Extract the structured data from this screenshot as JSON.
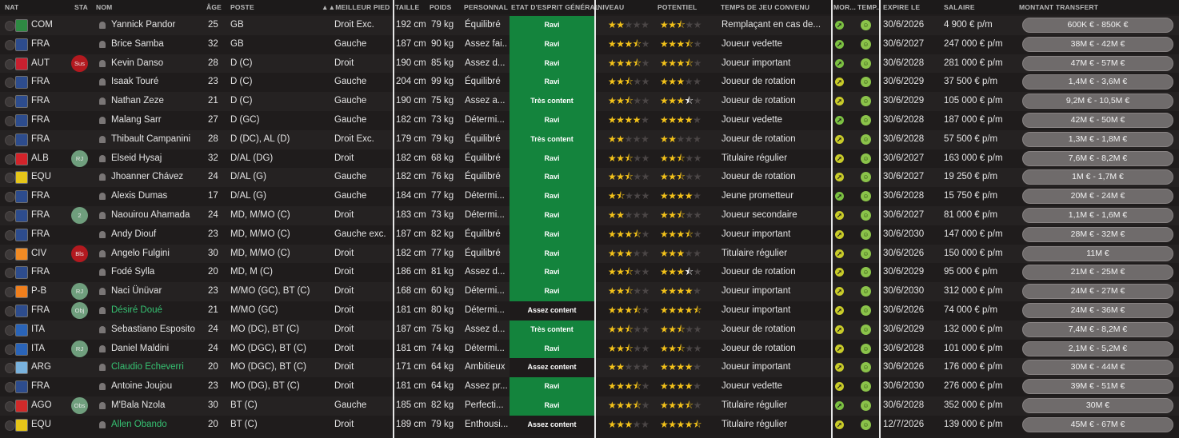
{
  "header": {
    "nat": "NAT",
    "sta": "STA",
    "nom": "NOM",
    "age": "ÂGE",
    "poste": "POSTE",
    "pied": "MEILLEUR PIED",
    "taille": "TAILLE",
    "poids": "POIDS",
    "perso": "PERSONNAL...",
    "etat": "ETAT D'ESPRIT GÉNÉRAL",
    "niveau": "NIVEAU",
    "potentiel": "POTENTIEL",
    "temps": "TEMPS DE JEU CONVENU",
    "mor": "MOR...",
    "temp": "TEMP...",
    "expire": "EXPIRE LE",
    "salaire": "SALAIRE",
    "transfert": "MONTANT TRANSFERT"
  },
  "colors": {
    "mood_green": "#14843d",
    "name_green": "#36c172",
    "star": "#f3c21a"
  },
  "players": [
    {
      "nat": "COM",
      "flag": "#2e8a43",
      "status": "",
      "status_color": "",
      "name": "Yannick Pandor",
      "green": false,
      "age": "25",
      "poste": "GB",
      "pied": "Droit Exc.",
      "taille": "192 cm",
      "poids": "79 kg",
      "perso": "Équilibré",
      "etat": "Ravi",
      "mood_green": true,
      "niveau": 2,
      "potentiel": 2.5,
      "pot_white": false,
      "temps": "Remplaçant en cas de...",
      "mor": "up",
      "mor_color": "#7cc142",
      "expire": "30/6/2026",
      "salaire": "4 900 € p/m",
      "transfert": "600K € - 850K €"
    },
    {
      "nat": "FRA",
      "flag": "#2d4c8d",
      "status": "",
      "status_color": "",
      "name": "Brice Samba",
      "green": false,
      "age": "32",
      "poste": "GB",
      "pied": "Gauche",
      "taille": "187 cm",
      "poids": "90 kg",
      "perso": "Assez fai...",
      "etat": "Ravi",
      "mood_green": true,
      "niveau": 3.5,
      "potentiel": 3.5,
      "pot_white": false,
      "temps": "Joueur vedette",
      "mor": "up",
      "mor_color": "#7cc142",
      "expire": "30/6/2027",
      "salaire": "247 000 € p/m",
      "transfert": "38M € - 42M €"
    },
    {
      "nat": "AUT",
      "flag": "#c8202f",
      "status": "Sus",
      "status_color": "#b3191f",
      "name": "Kevin Danso",
      "green": false,
      "age": "28",
      "poste": "D (C)",
      "pied": "Droit",
      "taille": "190 cm",
      "poids": "85 kg",
      "perso": "Assez d...",
      "etat": "Ravi",
      "mood_green": true,
      "niveau": 3.5,
      "potentiel": 3.5,
      "pot_white": false,
      "temps": "Joueur important",
      "mor": "up",
      "mor_color": "#7cc142",
      "expire": "30/6/2028",
      "salaire": "281 000 € p/m",
      "transfert": "47M € - 57M €"
    },
    {
      "nat": "FRA",
      "flag": "#2d4c8d",
      "status": "",
      "status_color": "",
      "name": "Isaak Touré",
      "green": false,
      "age": "23",
      "poste": "D (C)",
      "pied": "Gauche",
      "taille": "204 cm",
      "poids": "99 kg",
      "perso": "Équilibré",
      "etat": "Ravi",
      "mood_green": true,
      "niveau": 2.5,
      "potentiel": 3,
      "pot_white": false,
      "temps": "Joueur de rotation",
      "mor": "up",
      "mor_color": "#c9cc29",
      "expire": "30/6/2029",
      "salaire": "37 500 € p/m",
      "transfert": "1,4M € - 3,6M €"
    },
    {
      "nat": "FRA",
      "flag": "#2d4c8d",
      "status": "",
      "status_color": "",
      "name": "Nathan Zeze",
      "green": false,
      "age": "21",
      "poste": "D (C)",
      "pied": "Gauche",
      "taille": "190 cm",
      "poids": "75 kg",
      "perso": "Assez a...",
      "etat": "Très content",
      "mood_green": true,
      "niveau": 2.5,
      "potentiel": 3.5,
      "pot_white": true,
      "temps": "Joueur de rotation",
      "mor": "up",
      "mor_color": "#c9cc29",
      "expire": "30/6/2029",
      "salaire": "105 000 € p/m",
      "transfert": "9,2M € - 10,5M €"
    },
    {
      "nat": "FRA",
      "flag": "#2d4c8d",
      "status": "",
      "status_color": "",
      "name": "Malang Sarr",
      "green": false,
      "age": "27",
      "poste": "D (GC)",
      "pied": "Gauche",
      "taille": "182 cm",
      "poids": "73 kg",
      "perso": "Détermi...",
      "etat": "Ravi",
      "mood_green": true,
      "niveau": 4,
      "potentiel": 4,
      "pot_white": false,
      "temps": "Joueur vedette",
      "mor": "up",
      "mor_color": "#7cc142",
      "expire": "30/6/2028",
      "salaire": "187 000 € p/m",
      "transfert": "42M € - 50M €"
    },
    {
      "nat": "FRA",
      "flag": "#2d4c8d",
      "status": "",
      "status_color": "",
      "name": "Thibault Campanini",
      "green": false,
      "age": "28",
      "poste": "D (DC), AL (D)",
      "pied": "Droit Exc.",
      "taille": "179 cm",
      "poids": "79 kg",
      "perso": "Équilibré",
      "etat": "Très content",
      "mood_green": true,
      "niveau": 2,
      "potentiel": 2,
      "pot_white": false,
      "temps": "Joueur de rotation",
      "mor": "up",
      "mor_color": "#c9cc29",
      "expire": "30/6/2028",
      "salaire": "57 500 € p/m",
      "transfert": "1,3M € - 1,8M €"
    },
    {
      "nat": "ALB",
      "flag": "#d2232a",
      "status": "RJ",
      "status_color": "#6f9e7d",
      "name": "Elseid Hysaj",
      "green": false,
      "age": "32",
      "poste": "D/AL (DG)",
      "pied": "Droit",
      "taille": "182 cm",
      "poids": "68 kg",
      "perso": "Équilibré",
      "etat": "Ravi",
      "mood_green": true,
      "niveau": 2.5,
      "potentiel": 2.5,
      "pot_white": false,
      "temps": "Titulaire régulier",
      "mor": "up",
      "mor_color": "#c9cc29",
      "expire": "30/6/2027",
      "salaire": "163 000 € p/m",
      "transfert": "7,6M € - 8,2M €"
    },
    {
      "nat": "EQU",
      "flag": "#e6c619",
      "status": "",
      "status_color": "",
      "name": "Jhoanner Chávez",
      "green": false,
      "age": "24",
      "poste": "D/AL (G)",
      "pied": "Gauche",
      "taille": "182 cm",
      "poids": "76 kg",
      "perso": "Équilibré",
      "etat": "Ravi",
      "mood_green": true,
      "niveau": 2.5,
      "potentiel": 2.5,
      "pot_white": false,
      "temps": "Joueur de rotation",
      "mor": "up",
      "mor_color": "#c9cc29",
      "expire": "30/6/2027",
      "salaire": "19 250 € p/m",
      "transfert": "1M € - 1,7M €"
    },
    {
      "nat": "FRA",
      "flag": "#2d4c8d",
      "status": "",
      "status_color": "",
      "name": "Alexis Dumas",
      "green": false,
      "age": "17",
      "poste": "D/AL (G)",
      "pied": "Gauche",
      "taille": "184 cm",
      "poids": "77 kg",
      "perso": "Détermi...",
      "etat": "Ravi",
      "mood_green": true,
      "niveau": 1.5,
      "potentiel": 4,
      "pot_white": true,
      "temps": "Jeune prometteur",
      "mor": "up",
      "mor_color": "#7cc142",
      "expire": "30/6/2028",
      "salaire": "15 750 € p/m",
      "transfert": "20M € - 24M €"
    },
    {
      "nat": "FRA",
      "flag": "#2d4c8d",
      "status": "2",
      "status_color": "#6f9e7d",
      "name": "Naouirou Ahamada",
      "green": false,
      "age": "24",
      "poste": "MD, M/MO (C)",
      "pied": "Droit",
      "taille": "183 cm",
      "poids": "73 kg",
      "perso": "Détermi...",
      "etat": "Ravi",
      "mood_green": true,
      "niveau": 2,
      "potentiel": 2.5,
      "pot_white": false,
      "temps": "Joueur secondaire",
      "mor": "up",
      "mor_color": "#c9cc29",
      "expire": "30/6/2027",
      "salaire": "81 000 € p/m",
      "transfert": "1,1M € - 1,6M €"
    },
    {
      "nat": "FRA",
      "flag": "#2d4c8d",
      "status": "",
      "status_color": "",
      "name": "Andy Diouf",
      "green": false,
      "age": "23",
      "poste": "MD, M/MO (C)",
      "pied": "Gauche exc.",
      "taille": "187 cm",
      "poids": "82 kg",
      "perso": "Équilibré",
      "etat": "Ravi",
      "mood_green": true,
      "niveau": 3.5,
      "potentiel": 3.5,
      "pot_white": false,
      "temps": "Joueur important",
      "mor": "up",
      "mor_color": "#c9cc29",
      "expire": "30/6/2030",
      "salaire": "147 000 € p/m",
      "transfert": "28M € - 32M €"
    },
    {
      "nat": "CIV",
      "flag": "#f08a24",
      "status": "Bls",
      "status_color": "#b3191f",
      "name": "Angelo Fulgini",
      "green": false,
      "age": "30",
      "poste": "MD, M/MO (C)",
      "pied": "Droit",
      "taille": "182 cm",
      "poids": "77 kg",
      "perso": "Équilibré",
      "etat": "Ravi",
      "mood_green": true,
      "niveau": 3,
      "potentiel": 3,
      "pot_white": false,
      "temps": "Titulaire régulier",
      "mor": "up",
      "mor_color": "#c9cc29",
      "expire": "30/6/2026",
      "salaire": "150 000 € p/m",
      "transfert": "11M €"
    },
    {
      "nat": "FRA",
      "flag": "#2d4c8d",
      "status": "",
      "status_color": "",
      "name": "Fodé Sylla",
      "green": false,
      "age": "20",
      "poste": "MD, M (C)",
      "pied": "Droit",
      "taille": "186 cm",
      "poids": "81 kg",
      "perso": "Assez d...",
      "etat": "Ravi",
      "mood_green": true,
      "niveau": 2.5,
      "potentiel": 3.5,
      "pot_white": true,
      "temps": "Joueur de rotation",
      "mor": "up",
      "mor_color": "#c9cc29",
      "expire": "30/6/2029",
      "salaire": "95 000 € p/m",
      "transfert": "21M € - 25M €"
    },
    {
      "nat": "P-B",
      "flag": "#f07f1d",
      "status": "RJ",
      "status_color": "#6f9e7d",
      "name": "Naci Ünüvar",
      "green": false,
      "age": "23",
      "poste": "M/MO (GC), BT (C)",
      "pied": "Droit",
      "taille": "168 cm",
      "poids": "60 kg",
      "perso": "Détermi...",
      "etat": "Ravi",
      "mood_green": true,
      "niveau": 2.5,
      "potentiel": 4,
      "pot_white": false,
      "temps": "Joueur important",
      "mor": "up",
      "mor_color": "#c9cc29",
      "expire": "30/6/2030",
      "salaire": "312 000 € p/m",
      "transfert": "24M € - 27M €"
    },
    {
      "nat": "FRA",
      "flag": "#2d4c8d",
      "status": "Obj",
      "status_color": "#6f9e7d",
      "name": "Désiré Doué",
      "green": true,
      "age": "21",
      "poste": "M/MO (GC)",
      "pied": "Droit",
      "taille": "181 cm",
      "poids": "80 kg",
      "perso": "Détermi...",
      "etat": "Assez content",
      "mood_green": false,
      "niveau": 3.5,
      "potentiel": 4.5,
      "pot_white": false,
      "temps": "Joueur important",
      "mor": "up",
      "mor_color": "#c9cc29",
      "expire": "30/6/2026",
      "salaire": "74 000 € p/m",
      "transfert": "24M € - 36M €"
    },
    {
      "nat": "ITA",
      "flag": "#2a64b8",
      "status": "",
      "status_color": "",
      "name": "Sebastiano Esposito",
      "green": false,
      "age": "24",
      "poste": "MO (DC), BT (C)",
      "pied": "Droit",
      "taille": "187 cm",
      "poids": "75 kg",
      "perso": "Assez d...",
      "etat": "Très content",
      "mood_green": true,
      "niveau": 2.5,
      "potentiel": 2.5,
      "pot_white": false,
      "temps": "Joueur de rotation",
      "mor": "up",
      "mor_color": "#c9cc29",
      "expire": "30/6/2029",
      "salaire": "132 000 € p/m",
      "transfert": "7,4M € - 8,2M €"
    },
    {
      "nat": "ITA",
      "flag": "#2a64b8",
      "status": "RJ",
      "status_color": "#6f9e7d",
      "name": "Daniel Maldini",
      "green": false,
      "age": "24",
      "poste": "MO (DGC), BT (C)",
      "pied": "Droit",
      "taille": "181 cm",
      "poids": "74 kg",
      "perso": "Détermi...",
      "etat": "Ravi",
      "mood_green": true,
      "niveau": 2.5,
      "potentiel": 2.5,
      "pot_white": false,
      "temps": "Joueur de rotation",
      "mor": "up",
      "mor_color": "#c9cc29",
      "expire": "30/6/2028",
      "salaire": "101 000 € p/m",
      "transfert": "2,1M € - 5,2M €"
    },
    {
      "nat": "ARG",
      "flag": "#79b2dd",
      "status": "",
      "status_color": "",
      "name": "Claudio Echeverri",
      "green": true,
      "age": "20",
      "poste": "MO (DGC), BT (C)",
      "pied": "Droit",
      "taille": "171 cm",
      "poids": "64 kg",
      "perso": "Ambitieux",
      "etat": "Assez content",
      "mood_green": false,
      "niveau": 2,
      "potentiel": 4,
      "pot_white": true,
      "temps": "Joueur important",
      "mor": "up",
      "mor_color": "#c9cc29",
      "expire": "30/6/2026",
      "salaire": "176 000 € p/m",
      "transfert": "30M € - 44M €"
    },
    {
      "nat": "FRA",
      "flag": "#2d4c8d",
      "status": "",
      "status_color": "",
      "name": "Antoine Joujou",
      "green": false,
      "age": "23",
      "poste": "MO (DG), BT (C)",
      "pied": "Droit",
      "taille": "181 cm",
      "poids": "64 kg",
      "perso": "Assez pr...",
      "etat": "Ravi",
      "mood_green": true,
      "niveau": 3.5,
      "potentiel": 4,
      "pot_white": false,
      "temps": "Joueur vedette",
      "mor": "up",
      "mor_color": "#c9cc29",
      "expire": "30/6/2030",
      "salaire": "276 000 € p/m",
      "transfert": "39M € - 51M €"
    },
    {
      "nat": "AGO",
      "flag": "#d02a2a",
      "status": "Obs",
      "status_color": "#6f9e7d",
      "name": "M'Bala Nzola",
      "green": false,
      "age": "30",
      "poste": "BT (C)",
      "pied": "Gauche",
      "taille": "185 cm",
      "poids": "82 kg",
      "perso": "Perfecti...",
      "etat": "Ravi",
      "mood_green": true,
      "niveau": 3.5,
      "potentiel": 3.5,
      "pot_white": false,
      "temps": "Titulaire régulier",
      "mor": "up",
      "mor_color": "#7cc142",
      "expire": "30/6/2028",
      "salaire": "352 000 € p/m",
      "transfert": "30M €"
    },
    {
      "nat": "EQU",
      "flag": "#e6c619",
      "status": "",
      "status_color": "",
      "name": "Allen Obando",
      "green": true,
      "age": "20",
      "poste": "BT (C)",
      "pied": "Droit",
      "taille": "189 cm",
      "poids": "79 kg",
      "perso": "Enthousi...",
      "etat": "Assez content",
      "mood_green": false,
      "niveau": 3,
      "potentiel": 4.5,
      "pot_white": false,
      "temps": "Titulaire régulier",
      "mor": "up",
      "mor_color": "#c9cc29",
      "expire": "12/7/2026",
      "salaire": "139 000 € p/m",
      "transfert": "45M € - 67M €"
    }
  ]
}
